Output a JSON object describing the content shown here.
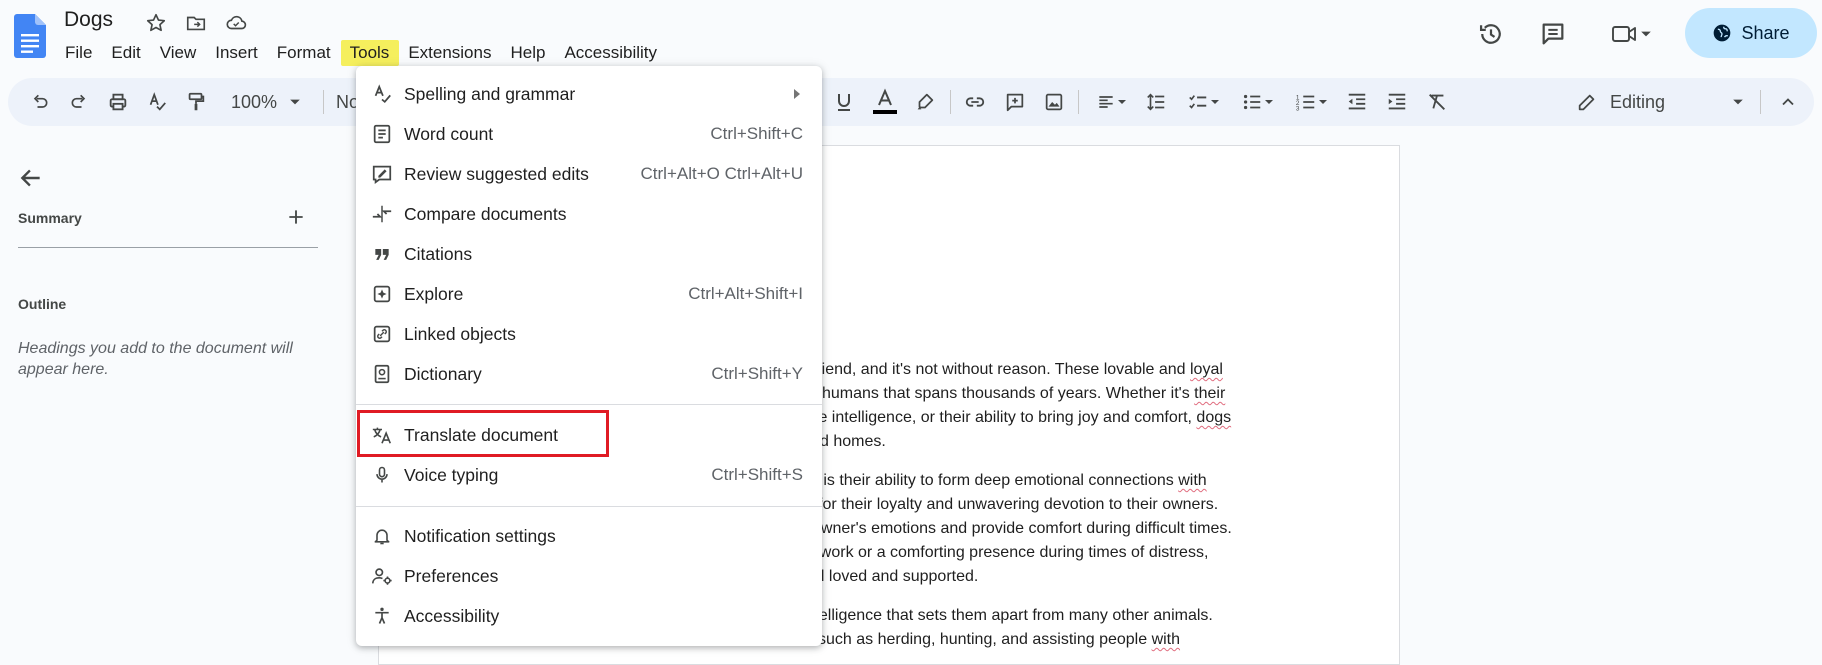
{
  "header": {
    "title": "Dogs",
    "menus": [
      "File",
      "Edit",
      "View",
      "Insert",
      "Format",
      "Tools",
      "Extensions",
      "Help",
      "Accessibility"
    ],
    "active_menu": "Tools",
    "share_label": "Share"
  },
  "toolbar": {
    "zoom": "100%",
    "style_partial": "No",
    "mode_label": "Editing"
  },
  "sidebar": {
    "summary_label": "Summary",
    "outline_label": "Outline",
    "outline_hint": "Headings you add to the document will appear here."
  },
  "tools_menu": {
    "items": [
      {
        "label": "Spelling and grammar",
        "shortcut": "",
        "icon": "spellcheck-icon",
        "submenu": true
      },
      {
        "label": "Word count",
        "shortcut": "Ctrl+Shift+C",
        "icon": "word-count-icon"
      },
      {
        "label": "Review suggested edits",
        "shortcut": "Ctrl+Alt+O Ctrl+Alt+U",
        "icon": "review-edits-icon"
      },
      {
        "label": "Compare documents",
        "shortcut": "",
        "icon": "compare-icon"
      },
      {
        "label": "Citations",
        "shortcut": "",
        "icon": "quote-icon"
      },
      {
        "label": "Explore",
        "shortcut": "Ctrl+Alt+Shift+I",
        "icon": "explore-icon"
      },
      {
        "label": "Linked objects",
        "shortcut": "",
        "icon": "link-objects-icon"
      },
      {
        "label": "Dictionary",
        "shortcut": "Ctrl+Shift+Y",
        "icon": "dictionary-icon"
      },
      {
        "label": "Translate document",
        "shortcut": "",
        "icon": "translate-icon"
      },
      {
        "label": "Voice typing",
        "shortcut": "Ctrl+Shift+S",
        "icon": "microphone-icon"
      },
      {
        "label": "Notification settings",
        "shortcut": "",
        "icon": "bell-icon"
      },
      {
        "label": "Preferences",
        "shortcut": "",
        "icon": "preferences-icon"
      },
      {
        "label": "Accessibility",
        "shortcut": "",
        "icon": "accessibility-icon"
      }
    ]
  },
  "document": {
    "lines": [
      {
        "pre": "t friend, and it's not without reason. These lovable and ",
        "flag": "loyal",
        "post": ""
      },
      {
        "pre": "humans that spans thousands of years. Whether it's ",
        "flag": "their",
        "post": ""
      },
      {
        "pre": "ble intelligence, or their ability to bring joy and comfort, ",
        "flag": "dogs",
        "post": ""
      },
      {
        "pre": "d homes.",
        "flag": "",
        "post": ""
      },
      {
        "pre": "gs is their ability to form deep emotional connections ",
        "flag": "with",
        "post": ""
      },
      {
        "pre": " for their loyalty and unwavering devotion to their owners.",
        "flag": "",
        "post": ""
      },
      {
        "pre": "owner's emotions and provide comfort during difficult times.",
        "flag": "",
        "post": ""
      },
      {
        "pre": "at work or a comforting presence during times of distress,",
        "flag": "",
        "post": ""
      },
      {
        "pre": "el loved and supported.",
        "flag": "",
        "post": ""
      },
      {
        "pre": "intelligence that sets them apart from many other animals.",
        "flag": "",
        "post": ""
      },
      {
        "pre": "such as herding, hunting, and assisting people ",
        "flag": "with",
        "post": ""
      }
    ]
  },
  "colors": {
    "accent_share": "#c2e7ff",
    "highlight_box": "#e01b24",
    "menu_active": "#f5ef5d",
    "text_color_bar": "#000000"
  }
}
